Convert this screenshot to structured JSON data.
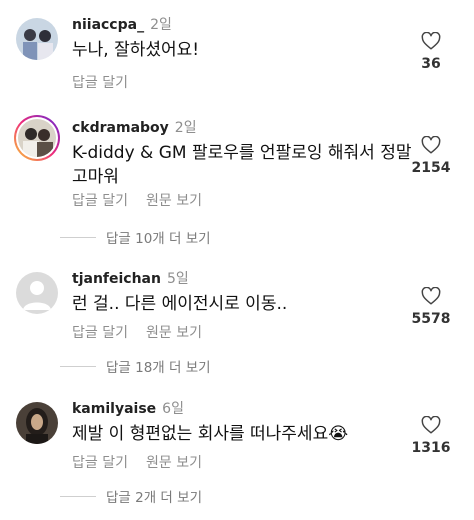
{
  "comments": [
    {
      "username": "niiaccpa_",
      "time": "2일",
      "text": "누나, 잘하셨어요!",
      "actions": [
        "답글 달기"
      ],
      "likes": "36",
      "avatar_icon": "avatar-photo-icon"
    },
    {
      "username": "ckdramaboy",
      "time": "2일",
      "text": "K-diddy & GM 팔로우를 언팔로잉 해줘서 정말 고마워",
      "actions": [
        "답글 달기",
        "원문 보기"
      ],
      "likes": "2154",
      "more_replies": "답글 10개 더 보기",
      "avatar_icon": "avatar-photo-story-ring-icon"
    },
    {
      "username": "tjanfeichan",
      "time": "5일",
      "text": "런 걸.. 다른 에이전시로 이동..",
      "actions": [
        "답글 달기",
        "원문 보기"
      ],
      "likes": "5578",
      "more_replies": "답글 18개 더 보기",
      "avatar_icon": "default-avatar-icon"
    },
    {
      "username": "kamilyaise",
      "time": "6일",
      "text": "제발 이 형편없는 회사를 떠나주세요😭",
      "actions": [
        "답글 달기",
        "원문 보기"
      ],
      "likes": "1316",
      "more_replies": "답글 2개 더 보기",
      "avatar_icon": "avatar-photo-icon"
    }
  ],
  "colors": {
    "secondary_text": "#8e8e8e",
    "primary_text": "#111111",
    "story_ring_start": "#f9ce34",
    "story_ring_end": "#c13584"
  },
  "icons": {
    "like": "heart-outline-icon"
  }
}
